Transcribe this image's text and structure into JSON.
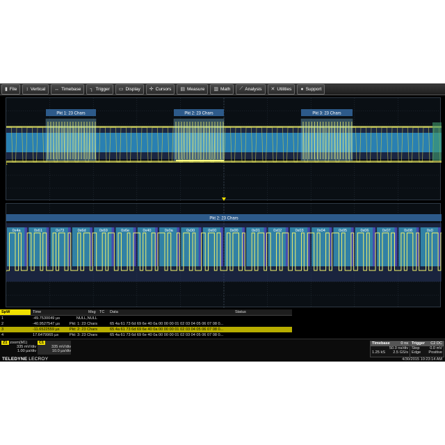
{
  "menu": [
    {
      "label": "File",
      "icon": "file-icon"
    },
    {
      "label": "Vertical",
      "icon": "vertical-icon"
    },
    {
      "label": "Timebase",
      "icon": "timebase-icon"
    },
    {
      "label": "Trigger",
      "icon": "trigger-icon"
    },
    {
      "label": "Display",
      "icon": "display-icon"
    },
    {
      "label": "Cursors",
      "icon": "cursors-icon"
    },
    {
      "label": "Measure",
      "icon": "measure-icon"
    },
    {
      "label": "Math",
      "icon": "math-icon"
    },
    {
      "label": "Analysis",
      "icon": "analysis-icon"
    },
    {
      "label": "Utilities",
      "icon": "utilities-icon"
    },
    {
      "label": "Support",
      "icon": "support-icon"
    }
  ],
  "top_panel": {
    "packet_labels": [
      "Pkt 1: 23 Chars",
      "Pkt 2: 23 Chars",
      "Pkt 3: 23 Chars"
    ],
    "trace_label": "C1"
  },
  "zoom_panel": {
    "packet_label": "Pkt 2: 23 Chars",
    "bytes": [
      "0x4a",
      "0x61",
      "0x73",
      "0x6d",
      "0x69",
      "0x6e",
      "0x40",
      "0x0a",
      "0x00",
      "0x00",
      "0x00",
      "0x01",
      "0x02",
      "0x03",
      "0x04",
      "0x05",
      "0x06",
      "0x07",
      "0x08",
      "0x0"
    ],
    "trace_label": "Z1"
  },
  "table": {
    "title": "SpW",
    "headers": {
      "time": "Time",
      "msg": "Msg",
      "tc": "TC",
      "data": "Data",
      "status": "Status"
    },
    "rows": [
      {
        "idx": "1",
        "time": "-49.7530049 µs",
        "msg": "NULL,NULL",
        "data": ""
      },
      {
        "idx": "2",
        "time": "-40.9527547 µs",
        "msg": "Pkt: 1: 23 Chars",
        "data": "65 4a 61 73 6d 69 6e 40 0a 00 00 00 01 02 03 04 05 06 07 08 0..."
      },
      {
        "idx": "3",
        "time": "-11.6522559 µs",
        "msg": "Pkt: 2: 23 Chars",
        "data": "65 4a 61 73 6d 69 6e 40 0a 00 00 00 01 02 03 04 05 06 07 08 0..."
      },
      {
        "idx": "4",
        "time": "17.6479965 µs",
        "msg": "Pkt: 3: 23 Chars",
        "data": "65 4a 61 73 6d 69 6e 40 0a 00 00 00 01 02 03 04 05 06 07 08 0..."
      }
    ],
    "selected_row": "3"
  },
  "descriptors": {
    "z1": {
      "tag": "Z1",
      "name": "zoom(M1)",
      "vdiv": "335 mV/div",
      "tdiv": "1.00 µs/div"
    },
    "c1": {
      "tag": "C1",
      "vdiv": "335 mV/div",
      "tdiv": "10.0 µs/div"
    }
  },
  "timebase": {
    "title": "Timebase",
    "delay": "0 ns",
    "tdiv": "50.0 ns/div",
    "samples": "1.25 kS",
    "rate": "2.5 GS/s"
  },
  "trigger": {
    "title": "Trigger",
    "channel": "C2 DC",
    "mode": "Stop",
    "level": "0.0 mV",
    "type": "Edge",
    "slope": "Positive"
  },
  "brand": {
    "name": "TELEDYNE",
    "sub": "LECROY"
  },
  "timestamp": "4/30/2015 10:23:14 AM",
  "colors": {
    "trace": "#e8e85a",
    "packet_box": "#6fb4d8",
    "accent": "#f0e000"
  }
}
